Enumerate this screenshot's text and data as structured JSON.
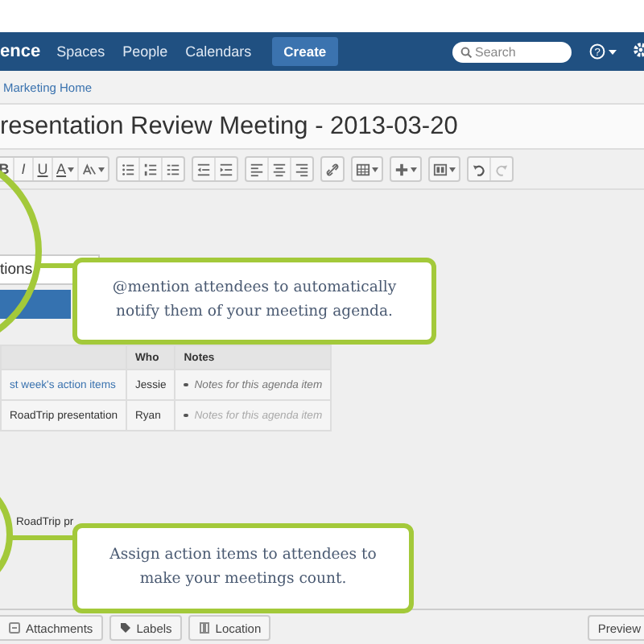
{
  "nav": {
    "logo": "ence",
    "links": [
      "Spaces",
      "People",
      "Calendars"
    ],
    "create": "Create",
    "search": {
      "placeholder": "Search"
    },
    "help": "?"
  },
  "breadcrumb": "Marketing Home",
  "title": "resentation Review Meeting - 2013-03-20",
  "toolbar": [
    [
      {
        "kind": "text",
        "label": "B",
        "dropdown": false
      },
      {
        "kind": "text",
        "label": "I",
        "dropdown": false
      },
      {
        "kind": "text",
        "label": "U",
        "dropdown": false
      },
      {
        "kind": "text",
        "label": "A",
        "dropdown": true
      },
      {
        "kind": "format",
        "dropdown": true
      }
    ],
    [
      {
        "kind": "bullets",
        "dropdown": false
      },
      {
        "kind": "numbers",
        "dropdown": false
      },
      {
        "kind": "tasks",
        "dropdown": false
      }
    ],
    [
      {
        "kind": "outdent",
        "dropdown": false
      },
      {
        "kind": "indent",
        "dropdown": false
      }
    ],
    [
      {
        "kind": "align-left",
        "dropdown": false
      },
      {
        "kind": "align-center",
        "dropdown": false
      },
      {
        "kind": "align-right",
        "dropdown": false
      }
    ],
    [
      {
        "kind": "link",
        "dropdown": false
      }
    ],
    [
      {
        "kind": "table",
        "dropdown": true
      }
    ],
    [
      {
        "kind": "insert",
        "dropdown": true
      }
    ],
    [
      {
        "kind": "layout",
        "dropdown": true
      }
    ],
    [
      {
        "kind": "undo",
        "dropdown": false
      },
      {
        "kind": "redo",
        "dropdown": false
      }
    ]
  ],
  "mention_field": {
    "value": "tions"
  },
  "table": {
    "columns": [
      "Who",
      "Notes"
    ],
    "rows": [
      {
        "item": "st week's action items",
        "link": true,
        "who": "Jessie",
        "notes": "Notes for this agenda item",
        "notes_placeholder": false
      },
      {
        "item": "RoadTrip presentation",
        "link": false,
        "who": "Ryan",
        "notes": "Notes for this agenda item",
        "notes_placeholder": true
      }
    ]
  },
  "action_item": "RoadTrip pr",
  "callouts": [
    "@mention attendees to automatically notify them of your meeting agenda.",
    "Assign action items to attendees to make your meetings count."
  ],
  "footer": {
    "buttons": [
      {
        "kind": "attachments",
        "label": "Attachments"
      },
      {
        "kind": "labels",
        "label": "Labels"
      },
      {
        "kind": "location",
        "label": "Location"
      }
    ],
    "preview": "Preview"
  }
}
